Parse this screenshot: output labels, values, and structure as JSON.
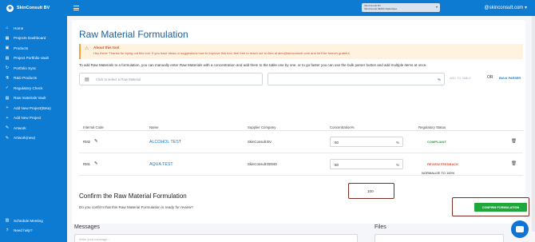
{
  "header": {
    "brand": "SkinConsult BV",
    "tenant_line1": "SkinConsult BV",
    "tenant_line2": "SkinConsult DEMO Radarbase",
    "user_email": "@skinconsult.com"
  },
  "sidebar": {
    "items": [
      {
        "label": "Home",
        "icon": "home-icon"
      },
      {
        "label": "Projects Dashboard",
        "icon": "dashboard-icon"
      },
      {
        "label": "Products",
        "icon": "box-icon"
      },
      {
        "label": "Project Portfolio Vault",
        "icon": "vault-icon"
      },
      {
        "label": "Portfolio Sync",
        "icon": "sync-icon"
      },
      {
        "label": "R&D Products",
        "icon": "flask-icon"
      },
      {
        "label": "Regulatory Check",
        "icon": "check-icon"
      },
      {
        "label": "Raw materials Vault",
        "icon": "vault-icon"
      },
      {
        "label": "Add New Project(Beta)",
        "icon": "plus-icon"
      },
      {
        "label": "Add New Project",
        "icon": "plus-icon"
      },
      {
        "label": "Artwork",
        "icon": "artwork-icon"
      },
      {
        "label": "Artwork(new)",
        "icon": "artwork-icon"
      }
    ],
    "bottom_items": [
      {
        "label": "Schedule Meeting",
        "icon": "calendar-icon"
      },
      {
        "label": "Need help?",
        "icon": "help-icon"
      }
    ]
  },
  "page": {
    "title": "Raw Material Formulation",
    "about_title": "About this tool",
    "about_body": "Hey there! Thanks for trying out this tool. If you have ideas or suggestions how to improve this tool, feel free to reach out to Alex at alex@skinconsult.com and he'll be forever grateful.",
    "intro": "To add Raw Materials to a formulation, you can manually enter Raw Materials with a concentration and add them to the table one by one, or to go faster you can use the bulk parser button and add multiple items at once.",
    "select_placeholder": "Click to select a Raw Material",
    "pct_symbol": "%",
    "add_to_table": "ADD TO TABLE",
    "or": "OR",
    "bulk_parser": "BULK PARSER"
  },
  "table": {
    "headers": [
      "Internal Code",
      "Name",
      "Supplier Company",
      "Concentration%",
      "Regulatory Status"
    ],
    "rows": [
      {
        "code": "RM2",
        "name": "ALCOHOL TEST",
        "supplier": "SkinConsult BV",
        "concentration": "50",
        "status": "COMPLIANT",
        "status_color": "#2e9e45"
      },
      {
        "code": "RM1",
        "name": "AQUA TEST",
        "supplier": "SkinConsult DEMO",
        "concentration": "50",
        "status": "REVIEW FEEDBACK",
        "status_color": "#e0533a"
      }
    ],
    "total": "100",
    "normalize": "NORMALIZE TO 100%"
  },
  "confirm": {
    "heading": "Confirm the Raw Material Formulation",
    "question": "Do you confirm that this Raw Material Formulation is ready for review?",
    "button": "CONFIRM FORMULATION"
  },
  "lower": {
    "messages_label": "Messages",
    "files_label": "Files",
    "message_placeholder": "Write your message..."
  }
}
